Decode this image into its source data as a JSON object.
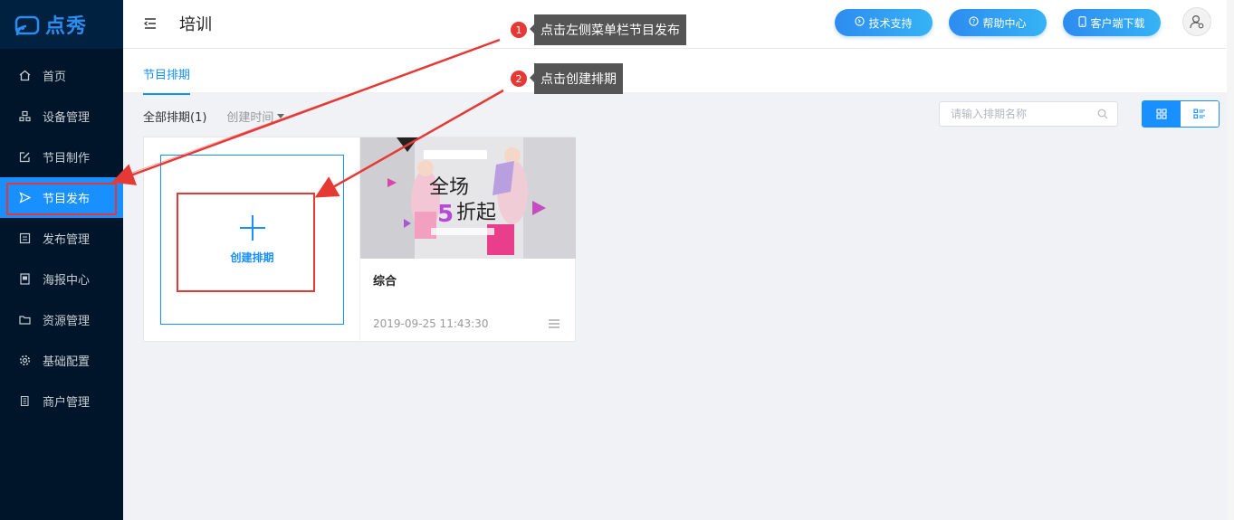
{
  "app": {
    "logo_text": "点秀"
  },
  "sidebar": {
    "items": [
      {
        "label": "首页",
        "icon": "home-icon"
      },
      {
        "label": "设备管理",
        "icon": "device-icon"
      },
      {
        "label": "节目制作",
        "icon": "edit-icon"
      },
      {
        "label": "节目发布",
        "icon": "send-icon"
      },
      {
        "label": "发布管理",
        "icon": "list-icon"
      },
      {
        "label": "海报中心",
        "icon": "poster-icon"
      },
      {
        "label": "资源管理",
        "icon": "folder-icon"
      },
      {
        "label": "基础配置",
        "icon": "gear-icon"
      },
      {
        "label": "商户管理",
        "icon": "merchant-icon"
      }
    ],
    "active_index": 3
  },
  "header": {
    "title": "培训",
    "buttons": [
      {
        "label": "技术支持",
        "icon": "support-icon"
      },
      {
        "label": "帮助中心",
        "icon": "help-icon"
      },
      {
        "label": "客户端下载",
        "icon": "mobile-icon"
      }
    ]
  },
  "main": {
    "tab": "节目排期",
    "filter_all": "全部排期(1)",
    "sort_label": "创建时间",
    "search_placeholder": "请输入排期名称",
    "create_label": "创建排期",
    "program": {
      "name": "综合",
      "date": "2019-09-25 11:43:30",
      "thumb_text_1": "全场",
      "thumb_text_2": "5",
      "thumb_text_3": "折起"
    }
  },
  "callouts": [
    {
      "num": "1",
      "text": "点击左侧菜单栏节目发布"
    },
    {
      "num": "2",
      "text": "点击创建排期"
    }
  ],
  "colors": {
    "primary": "#1890ff",
    "sidebar": "#001529",
    "highlight": "#e53935"
  }
}
